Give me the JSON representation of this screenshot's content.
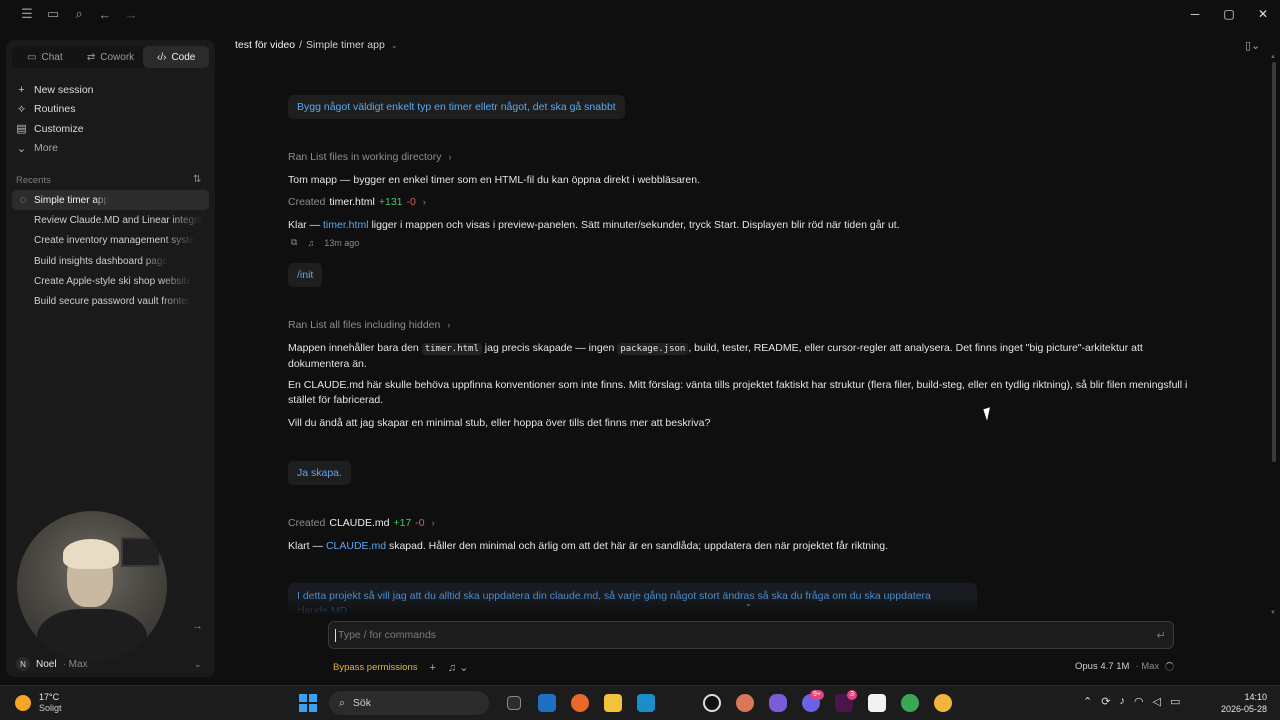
{
  "sidebar": {
    "tabs": [
      {
        "label": "Chat",
        "icon": "chat-bubble-icon"
      },
      {
        "label": "Cowork",
        "icon": "cowork-icon"
      },
      {
        "label": "Code",
        "icon": "code-brackets-icon"
      }
    ],
    "nav": [
      {
        "label": "New session",
        "icon": "plus-icon"
      },
      {
        "label": "Routines",
        "icon": "routines-icon"
      },
      {
        "label": "Customize",
        "icon": "customize-icon"
      },
      {
        "label": "More",
        "icon": "chevron-down-icon"
      }
    ],
    "recents_label": "Recents",
    "recents": [
      "Simple timer app",
      "Review Claude.MD and Linear integra",
      "Create inventory management syste",
      "Build insights dashboard page",
      "Create Apple-style ski shop website",
      "Build secure password vault fronten"
    ],
    "user": {
      "initial": "N",
      "name": "Noel",
      "plan": "· Max"
    }
  },
  "header": {
    "project": "test för video",
    "separator": "/",
    "session": "Simple timer app"
  },
  "conversation": {
    "msg1": "Bygg något väldigt enkelt typ en timer elletr något, det ska gå snabbt",
    "tool1": "Ran List files in working directory",
    "para1": "Tom mapp — bygger en enkel timer som en HTML-fil du kan öppna direkt i webbläsaren.",
    "created1": {
      "prefix": "Created",
      "file": "timer.html",
      "plus": "+131",
      "minus": "-0"
    },
    "para2": {
      "prefix": "Klar —",
      "link": "timer.html",
      "rest": "ligger i mappen och visas i preview-panelen. Sätt minuter/sekunder, tryck Start. Displayen blir röd när tiden går ut."
    },
    "time_ago": "13m ago",
    "msg2": "/init",
    "tool2": "Ran List all files including hidden",
    "para3": {
      "a": "Mappen innehåller bara den",
      "code1": "timer.html",
      "b": "jag precis skapade — ingen",
      "code2": "package.json",
      "c": ", build, tester, README, eller cursor-regler att analysera. Det finns inget \"big picture\"-arkitektur att dokumentera än."
    },
    "para4": "En CLAUDE.md här skulle behöva uppfinna konventioner som inte finns. Mitt förslag: vänta tills projektet faktiskt har struktur (flera filer, build-steg, eller en tydlig riktning), så blir filen meningsfull i stället för fabricerad.",
    "para5": "Vill du ändå att jag skapar en minimal stub, eller hoppa över tills det finns mer att beskriva?",
    "msg3": "Ja skapa.",
    "created2": {
      "prefix": "Created",
      "file": "CLAUDE.md",
      "plus": "+17",
      "minus": "-0"
    },
    "para6": {
      "prefix": "Klart —",
      "link": "CLAUDE.md",
      "rest": "skapad. Håller den minimal och ärlig om att det här är en sandlåda; uppdatera den när projektet får riktning."
    },
    "queued": "I detta projekt så vill jag att du alltid ska uppdatera din claude.md, så varje gång något stort ändras så ska du fråga om du ska uppdatera claude.MD"
  },
  "composer": {
    "placeholder": "Type / for commands",
    "bypass": "Bypass permissions",
    "model": "Opus 4.7 1M",
    "model_meta": "· Max"
  },
  "taskbar": {
    "temp": "17°C",
    "condition": "Soligt",
    "search": "Sök",
    "badges": {
      "messenger": "9+",
      "slack": "3"
    },
    "time": "14:10",
    "date": "2026-05-28"
  }
}
